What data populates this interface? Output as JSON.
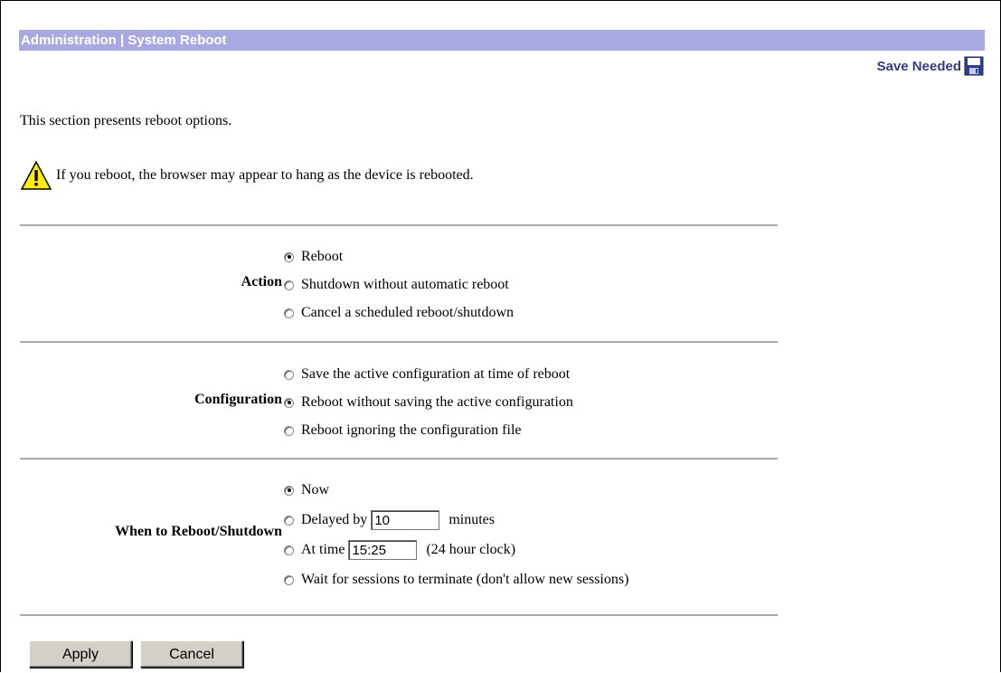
{
  "header": {
    "title": "Administration | System Reboot",
    "save_needed": "Save Needed"
  },
  "intro": "This section presents reboot options.",
  "warning": "If you reboot, the browser may appear to hang as the device is rebooted.",
  "action": {
    "label": "Action",
    "options": [
      {
        "label": "Reboot",
        "selected": true
      },
      {
        "label": "Shutdown without automatic reboot",
        "selected": false
      },
      {
        "label": "Cancel a scheduled reboot/shutdown",
        "selected": false
      }
    ]
  },
  "configuration": {
    "label": "Configuration",
    "options": [
      {
        "label": "Save the active configuration at time of reboot",
        "selected": false
      },
      {
        "label": "Reboot without saving the active configuration",
        "selected": true
      },
      {
        "label": "Reboot ignoring the configuration file",
        "selected": false
      }
    ]
  },
  "when": {
    "label": "When to Reboot/Shutdown",
    "now": "Now",
    "delayed_prefix": "Delayed by",
    "delayed_value": "10",
    "delayed_suffix": "minutes",
    "at_prefix": "At time",
    "at_value": "15:25",
    "at_suffix": "(24 hour clock)",
    "wait": "Wait for sessions to terminate (don't allow new sessions)",
    "selected": "now"
  },
  "buttons": {
    "apply": "Apply",
    "cancel": "Cancel"
  },
  "colors": {
    "titlebar": "#a9a9e2",
    "save_needed": "#3a3a80"
  }
}
